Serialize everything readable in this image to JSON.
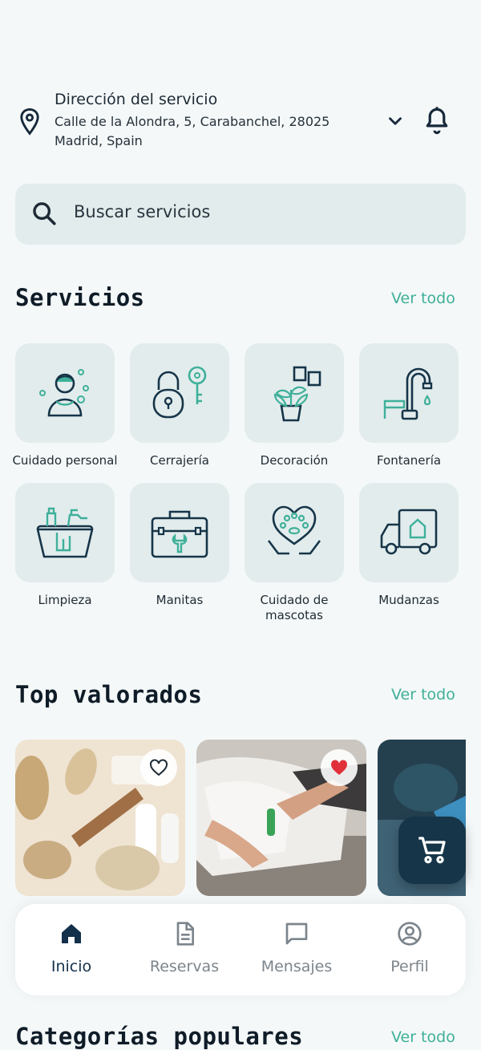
{
  "header": {
    "address_title": "Dirección del servicio",
    "address_line": "Calle de la Alondra, 5, Carabanchel, 28025 Madrid, Spain"
  },
  "search": {
    "placeholder": "Buscar servicios"
  },
  "services": {
    "title": "Servicios",
    "see_all": "Ver todo",
    "items": [
      {
        "label": "Cuidado personal",
        "icon": "person-care-icon"
      },
      {
        "label": "Cerrajería",
        "icon": "padlock-key-icon"
      },
      {
        "label": "Decoración",
        "icon": "plant-frames-icon"
      },
      {
        "label": "Fontanería",
        "icon": "faucet-icon"
      },
      {
        "label": "Limpieza",
        "icon": "cleaning-bucket-icon"
      },
      {
        "label": "Manitas",
        "icon": "toolbox-icon"
      },
      {
        "label": "Cuidado de mascotas",
        "icon": "pet-heart-hands-icon"
      },
      {
        "label": "Mudanzas",
        "icon": "moving-truck-icon"
      }
    ]
  },
  "top_rated": {
    "title": "Top valorados",
    "see_all": "Ver todo",
    "cards": [
      {
        "favorite": false
      },
      {
        "favorite": true
      },
      {
        "favorite": false
      }
    ]
  },
  "popular_categories": {
    "title": "Categorías populares",
    "see_all": "Ver todo"
  },
  "bottom_nav": {
    "items": [
      {
        "label": "Inicio",
        "icon": "home-icon",
        "active": true
      },
      {
        "label": "Reservas",
        "icon": "document-icon",
        "active": false
      },
      {
        "label": "Mensajes",
        "icon": "chat-icon",
        "active": false
      },
      {
        "label": "Perfil",
        "icon": "profile-icon",
        "active": false
      }
    ]
  },
  "colors": {
    "accent": "#3fb09a",
    "navy": "#163549",
    "tile_bg": "#e2ecec",
    "favorite_red": "#e0303a"
  }
}
